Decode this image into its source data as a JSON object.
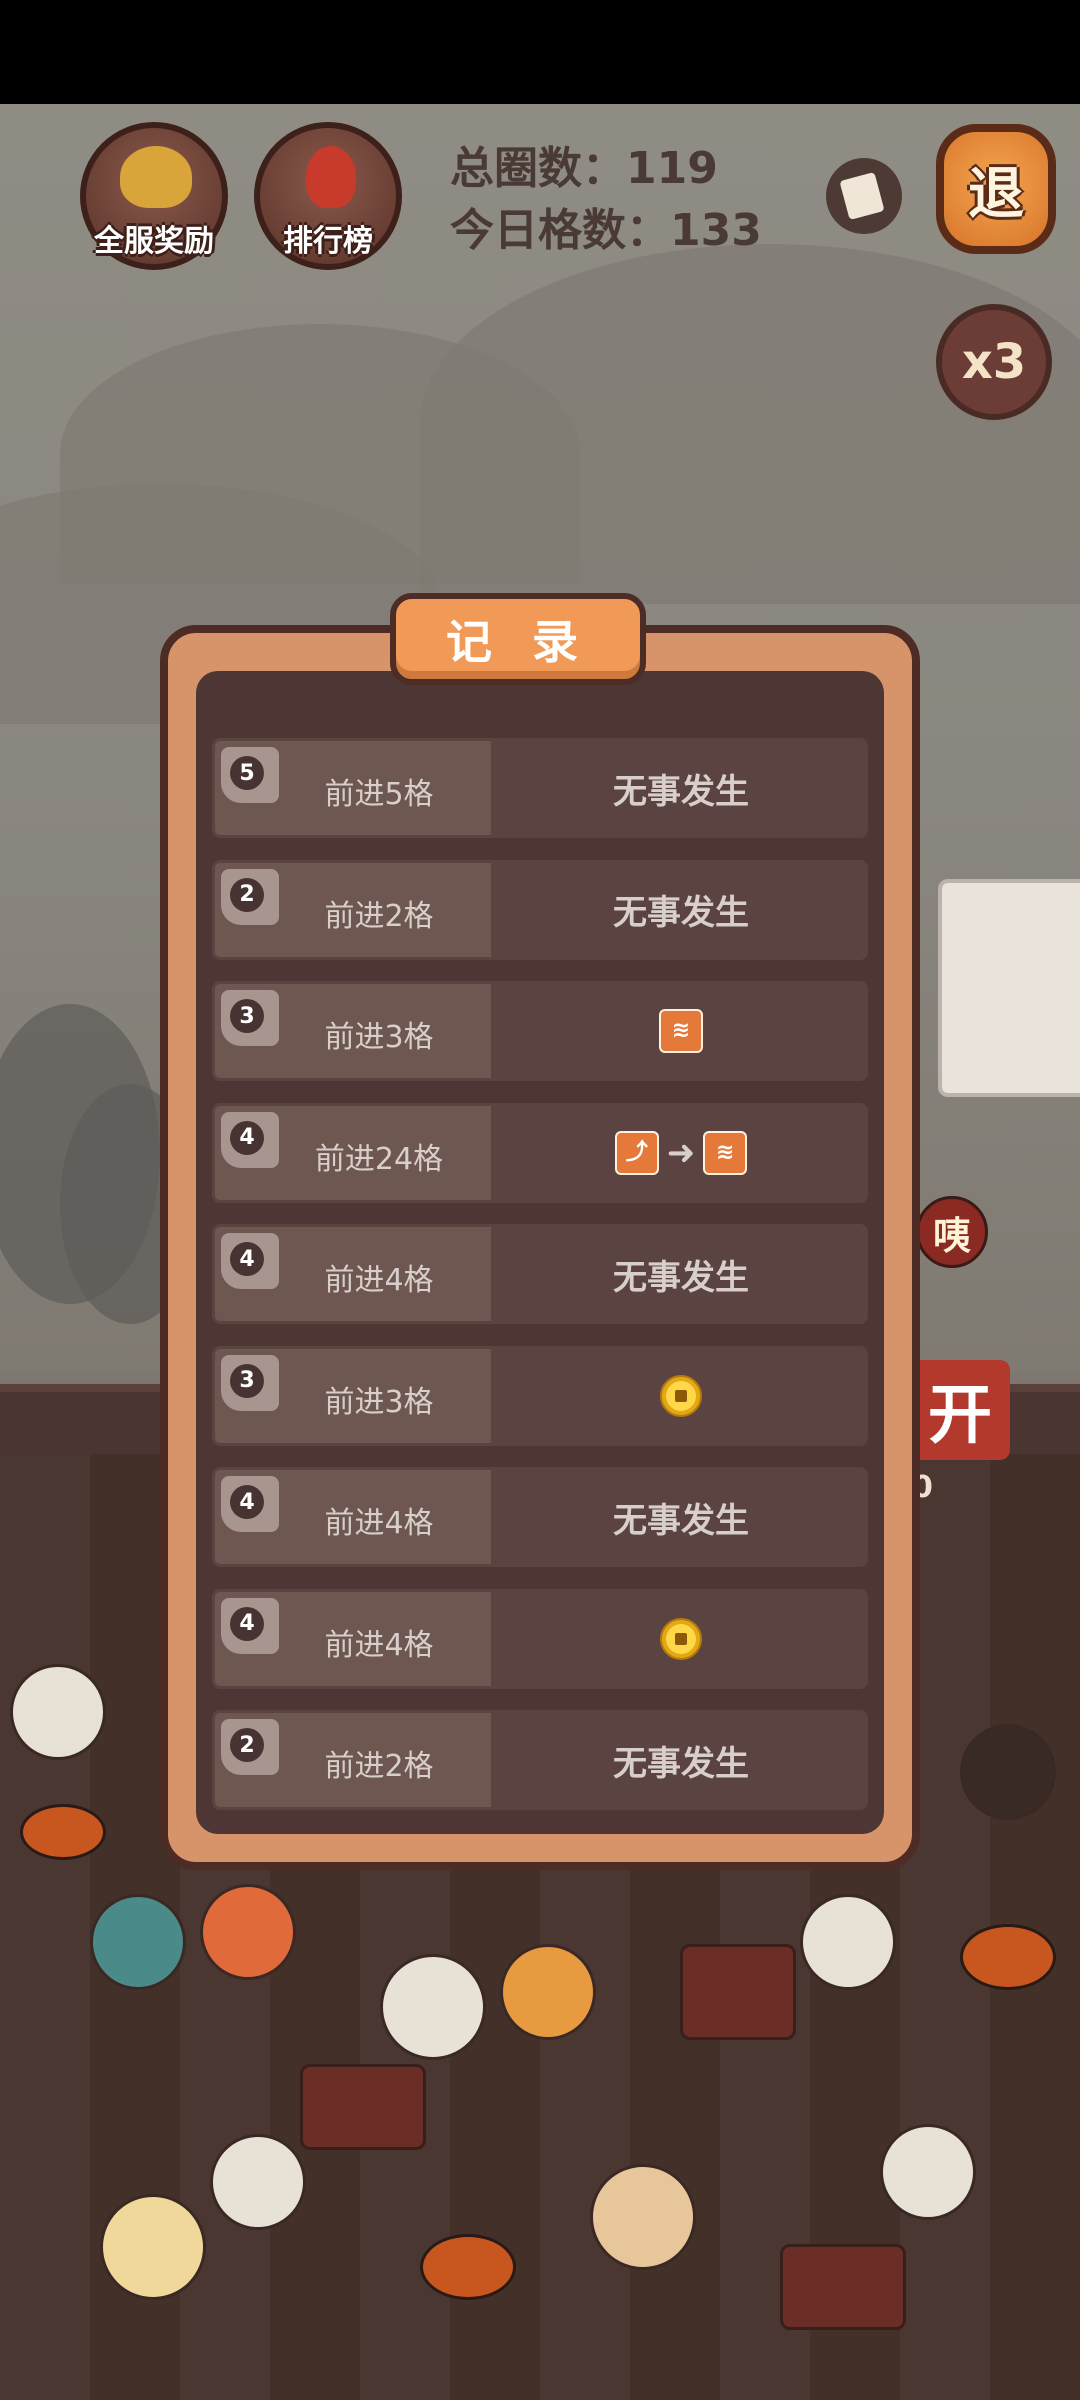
{
  "header": {
    "server_reward_label": "全服奖励",
    "leaderboard_label": "排行榜",
    "total_laps_label": "总圈数：",
    "total_laps_value": "119",
    "today_steps_label": "今日格数：",
    "today_steps_value": "133",
    "exit_label": "退",
    "speed_label": "x3"
  },
  "dialog": {
    "title": "记 录",
    "records": [
      {
        "dice": "5",
        "label": "前进5格",
        "result_text": "无事发生",
        "result_icons": []
      },
      {
        "dice": "2",
        "label": "前进2格",
        "result_text": "无事发生",
        "result_icons": []
      },
      {
        "dice": "3",
        "label": "前进3格",
        "result_text": "",
        "result_icons": [
          "tile-icon"
        ]
      },
      {
        "dice": "4",
        "label": "前进24格",
        "result_text": "",
        "result_icons": [
          "shortcut-tile-icon",
          "arrow-icon",
          "tile-icon"
        ]
      },
      {
        "dice": "4",
        "label": "前进4格",
        "result_text": "无事发生",
        "result_icons": []
      },
      {
        "dice": "3",
        "label": "前进3格",
        "result_text": "",
        "result_icons": [
          "coin-icon"
        ]
      },
      {
        "dice": "4",
        "label": "前进4格",
        "result_text": "无事发生",
        "result_icons": []
      },
      {
        "dice": "4",
        "label": "前进4格",
        "result_text": "",
        "result_icons": [
          "coin-icon"
        ]
      },
      {
        "dice": "2",
        "label": "前进2格",
        "result_text": "无事发生",
        "result_icons": []
      }
    ]
  },
  "background": {
    "side_tag_char": "咦",
    "side_big_char": "开",
    "side_small_text": "0"
  }
}
